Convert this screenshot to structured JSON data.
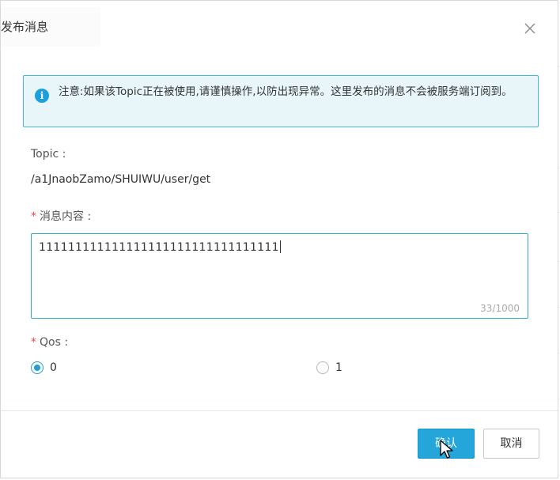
{
  "dialog": {
    "title": "发布消息",
    "close_icon": "close-icon"
  },
  "notice": {
    "icon": "info-icon",
    "icon_glyph": "i",
    "text": "注意:如果该Topic正在被使用,请谨慎操作,以防出现异常。这里发布的消息不会被服务端订阅到。"
  },
  "form": {
    "topic_label": "Topic :",
    "topic_value": "/a1JnaobZamo/SHUIWU/user/get",
    "content_label": "消息内容 :",
    "required_mark": "*",
    "content_value": "111111111111111111111111111111111",
    "char_count": "33/1000",
    "qos_label": "Qos :",
    "qos_options": [
      {
        "label": "0",
        "checked": true
      },
      {
        "label": "1",
        "checked": false
      }
    ]
  },
  "buttons": {
    "confirm": "确认",
    "cancel": "取消"
  },
  "colors": {
    "accent": "#24a6da",
    "notice_border": "#43b9d6",
    "notice_bg": "#e8f6fa",
    "required": "#e24b4b"
  }
}
